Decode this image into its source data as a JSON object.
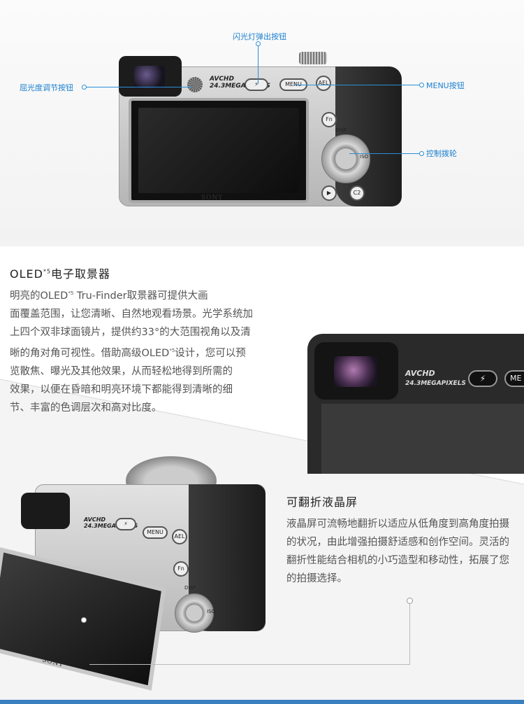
{
  "top": {
    "callouts": {
      "flash_button": "闪光灯弹出按钮",
      "diopter_button": "屈光度调节按钮",
      "menu_button": "MENU按钮",
      "control_wheel": "控制拨轮"
    },
    "camera": {
      "brand": "SONY",
      "avchd": "AVCHD",
      "megapixels": "24.3MEGAPIXELS",
      "menu": "MENU",
      "ael": "AEL",
      "fn": "Fn",
      "disp": "DISP",
      "iso": "ISO",
      "c2": "C2"
    }
  },
  "oled_section": {
    "title_prefix": "OLED",
    "title_sup": "*5",
    "title_suffix": "电子取景器",
    "lines": [
      "明亮的OLED",
      " Tru-Finder取景器可提供大画",
      "面覆盖范围，让您清晰、自然地观看场景。光学系统加",
      "上四个双非球面镜片，提供约33°的大范围视角以及清",
      "晰的角对角可视性。借助高级OLED",
      "设计，您可以预",
      "览散焦、曝光及其他效果，从而轻松地得到所需的",
      "效果，以便在昏暗和明亮环境下都能得到清晰的细",
      "节、丰富的色调层次和高对比度。"
    ],
    "sup_mark": "*5"
  },
  "closeup": {
    "avchd": "AVCHD",
    "megapixels": "24.3MEGAPIXELS",
    "menu_partial": "ME"
  },
  "lcd_section": {
    "title": "可翻折液晶屏",
    "paragraph": "液晶屏可流畅地翻折以适应从低角度到高角度拍摄的状况，由此增强拍摄舒适感和创作空间。灵活的翻折性能结合相机的小巧造型和移动性，拓展了您的拍摄选择。"
  },
  "front_camera": {
    "brand": "SONY",
    "avchd": "AVCHD",
    "megapixels": "24.3MEGAPIXELS",
    "menu": "MENU",
    "ael": "AEL",
    "fn": "Fn",
    "disp": "DISP",
    "iso": "ISO"
  },
  "colors": {
    "callout_blue": "#2a8fd6",
    "bottom_bar": "#3a7fc0"
  }
}
